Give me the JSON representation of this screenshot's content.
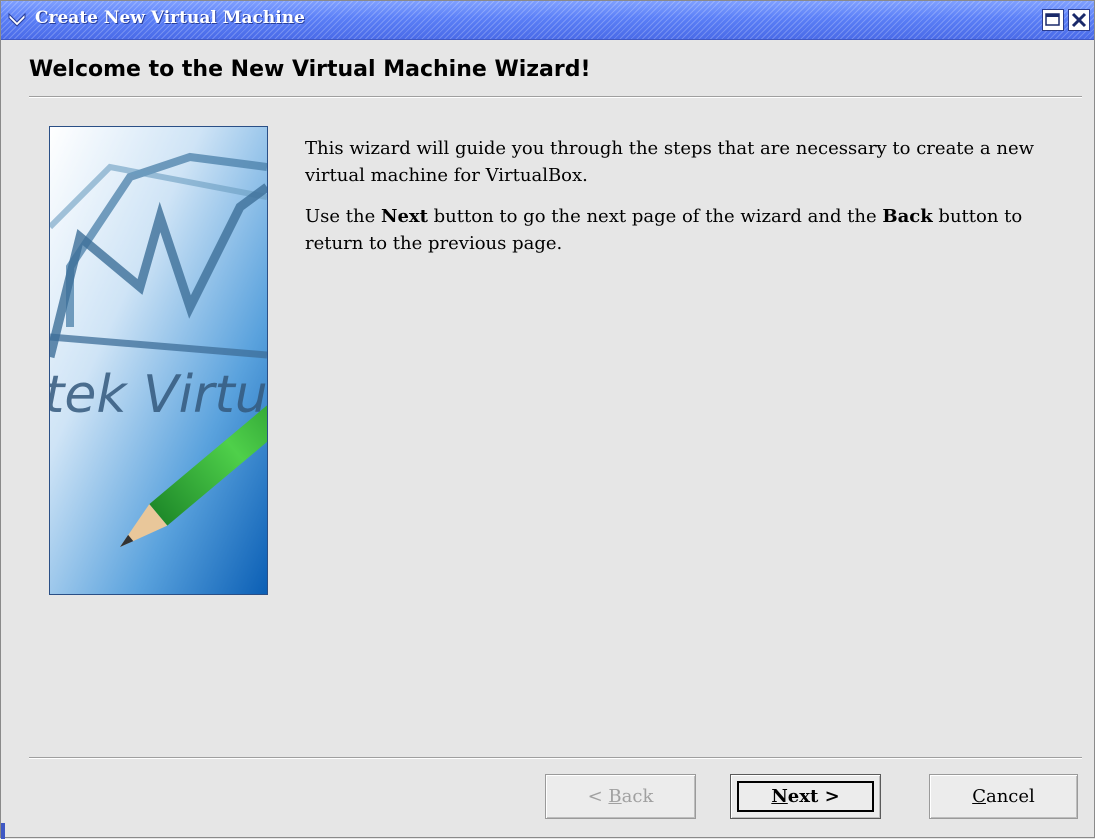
{
  "window": {
    "title": "Create New Virtual Machine"
  },
  "header": {
    "title": "Welcome to the New Virtual Machine Wizard!"
  },
  "image": {
    "logo_text": "tek Virtua"
  },
  "body": {
    "para1": "This wizard will guide you through the steps that are necessary to create a new virtual machine for VirtualBox.",
    "para2_prefix": "Use the ",
    "para2_next": "Next",
    "para2_mid": " button to go the next page of the wizard and the ",
    "para2_back": "Back",
    "para2_suffix": " button to return to the previous page."
  },
  "buttons": {
    "back_arrow": "<",
    "back_mnemonic": "B",
    "back_rest": "ack",
    "back_enabled": false,
    "next_mnemonic": "N",
    "next_rest": "ext",
    "next_arrow": ">",
    "cancel_mnemonic": "C",
    "cancel_rest": "ancel"
  },
  "colors": {
    "titlebar": "#5b7ff7",
    "background": "#e6e6e6",
    "image_blue": "#1d6fc2"
  },
  "icons": {
    "title_menu": "chevron-down-icon",
    "maximize": "maximize-icon",
    "close": "close-icon"
  }
}
